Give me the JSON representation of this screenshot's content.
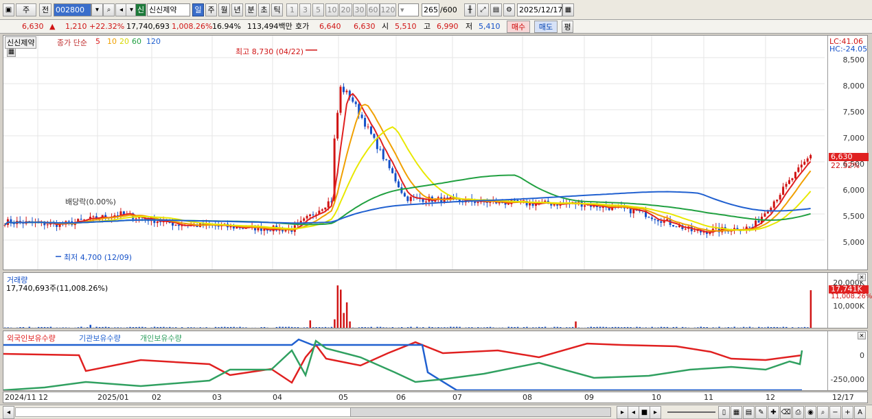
{
  "toolbar": {
    "mode1": "주",
    "mode2": "전",
    "code": "002800",
    "market_badge": "신",
    "name": "신신제약",
    "periods": [
      "일",
      "주",
      "월",
      "년",
      "분",
      "초",
      "틱"
    ],
    "minutes": [
      "1",
      "3",
      "5",
      "10",
      "20",
      "30",
      "60",
      "120"
    ],
    "count": "265",
    "count_max": "/600",
    "date": "2025/12/17"
  },
  "quote": {
    "price": "6,630",
    "up_arrow": "▲",
    "change": "1,210",
    "change_pct": "+22.32%",
    "volume": "17,740,693",
    "vol_pct": "1,008.26%",
    "turnover": "16.94%",
    "amount": "113,494백만",
    "hoga_label": "호가",
    "ask": "6,640",
    "bid": "6,630",
    "open_label": "시",
    "open": "5,510",
    "high_label": "고",
    "high": "6,990",
    "low_label": "저",
    "low": "5,410",
    "buy": "매수",
    "sell": "매도",
    "avg": "평"
  },
  "price_panel": {
    "name_tag": "신신제약",
    "ma_label": "종가 단순",
    "ma_periods": [
      "5",
      "10",
      "20",
      "60",
      "120"
    ],
    "ma_colors": [
      "#e02020",
      "#f0a000",
      "#e8e800",
      "#20a040",
      "#2060d0"
    ],
    "lc": "LC:41.06",
    "hc": "HC:-24.05",
    "max_note": "최고 8,730 (04/22)",
    "min_note": "최저 4,700 (12/09)",
    "dividend_note": "배당락(0.00%)",
    "y_ticks": [
      "8,500",
      "8,000",
      "7,500",
      "7,000",
      "6,500",
      "6,000",
      "5,500",
      "5,000"
    ],
    "last_price": "6,630",
    "last_pct": "22.32%"
  },
  "volume_panel": {
    "title": "거래량",
    "value": "17,740,693주(11,008.26%)",
    "y_ticks": [
      "20,000K",
      "10,000K"
    ],
    "last": "17,741K",
    "last_pct": "11,008.26%"
  },
  "holding_panel": {
    "foreign": "외국인보유수량",
    "inst": "기관보유수량",
    "indiv": "개인보유수량",
    "y_ticks": [
      "0",
      "-250,000"
    ],
    "colors": {
      "foreign": "#e02020",
      "inst": "#2060d0",
      "indiv": "#30a060"
    }
  },
  "x_axis": {
    "labels": [
      "2024/11",
      "12",
      "2025/01",
      "02",
      "03",
      "04",
      "05",
      "06",
      "07",
      "08",
      "09",
      "10",
      "11",
      "12"
    ],
    "current": "12/17"
  },
  "chart_data": [
    {
      "type": "line",
      "title": "신신제약",
      "ylabel": "",
      "ylim": [
        4500,
        8800
      ],
      "x": [
        "2024/11",
        "12",
        "2025/01",
        "02",
        "03",
        "04",
        "05",
        "06",
        "07",
        "08",
        "09",
        "10",
        "11",
        "12",
        "12/17"
      ],
      "series": [
        {
          "name": "종가",
          "values": [
            5350,
            5300,
            5500,
            5300,
            5250,
            5200,
            6050,
            5800,
            5750,
            5700,
            5700,
            5550,
            5150,
            5250,
            6630
          ]
        }
      ],
      "annotations": [
        "최고 8,730 (04/22)",
        "최저 4,700 (12/09)"
      ]
    },
    {
      "type": "bar",
      "title": "거래량",
      "ylabel": "",
      "ylim": [
        0,
        22000
      ],
      "x": [
        "04/22",
        "12/17"
      ],
      "series": [
        {
          "name": "거래량",
          "values": [
            20000,
            17741
          ]
        }
      ]
    }
  ]
}
